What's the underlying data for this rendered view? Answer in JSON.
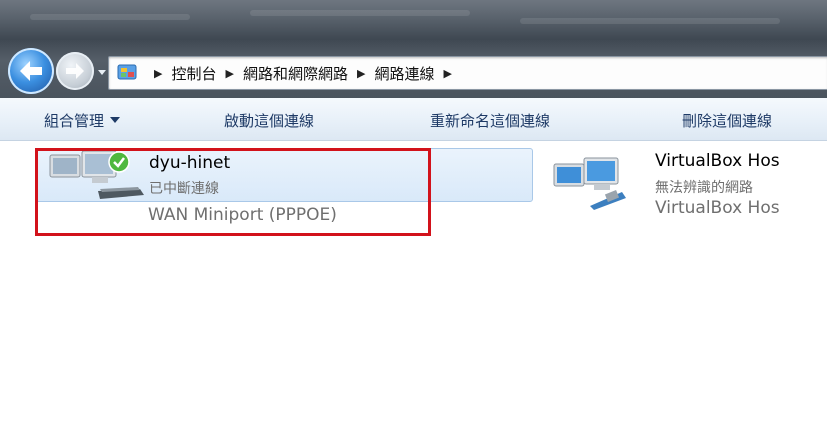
{
  "address_bar": {
    "breadcrumbs": [
      "控制台",
      "網路和網際網路",
      "網路連線"
    ]
  },
  "toolbar": {
    "organize_label": "組合管理",
    "start_label": "啟動這個連線",
    "rename_label": "重新命名這個連線",
    "delete_label": "刪除這個連線"
  },
  "connections": [
    {
      "name": "dyu-hinet",
      "status": "已中斷連線",
      "device": "WAN Miniport (PPPOE)",
      "status_icon": "green-check-icon",
      "icon": "dialup-network-icon"
    },
    {
      "name": "VirtualBox Hos",
      "status": "無法辨識的網路",
      "device": "VirtualBox Hos",
      "icon": "ethernet-network-icon"
    }
  ],
  "colors": {
    "highlight_border": "#d2121b",
    "selection_fill": "#dceafa",
    "toolbar_text": "#1e3a66"
  }
}
